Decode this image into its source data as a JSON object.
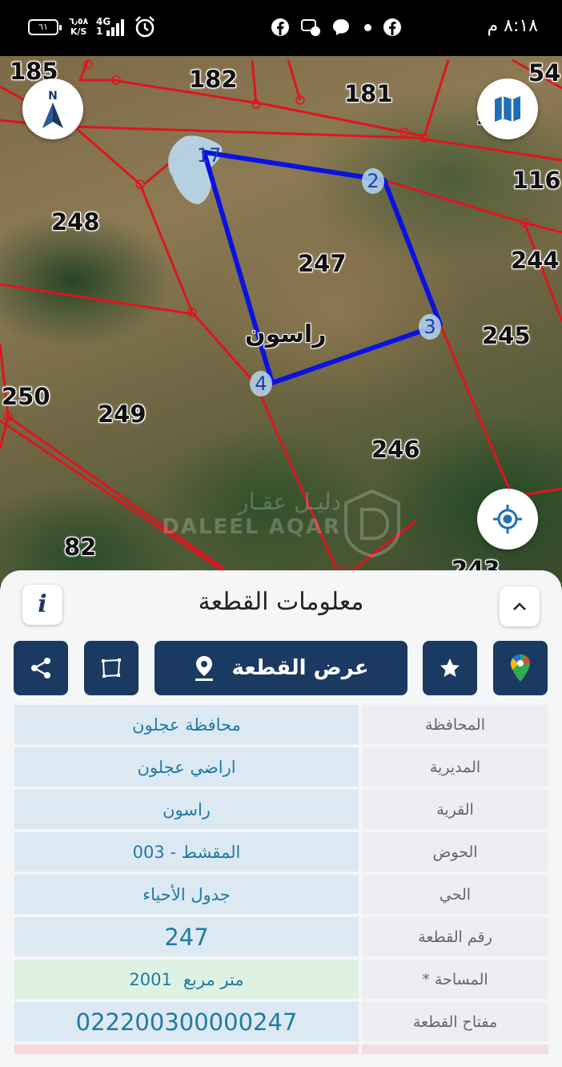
{
  "status_bar": {
    "time": "٨:١٨ م",
    "battery": "٦١",
    "net_speed_value": "٦٫٥٨",
    "net_speed_unit": "K/S",
    "network": "4G",
    "network_sub": "1"
  },
  "map": {
    "plot_numbers": [
      {
        "id": "p185",
        "label": "185"
      },
      {
        "id": "p182",
        "label": "182"
      },
      {
        "id": "p181",
        "label": "181"
      },
      {
        "id": "p54",
        "label": "54"
      },
      {
        "id": "p1",
        "label": "1"
      },
      {
        "id": "p116",
        "label": "116"
      },
      {
        "id": "p248",
        "label": "248"
      },
      {
        "id": "p247",
        "label": "247"
      },
      {
        "id": "p244",
        "label": "244"
      },
      {
        "id": "p245",
        "label": "245"
      },
      {
        "id": "p250",
        "label": "250"
      },
      {
        "id": "p249",
        "label": "249"
      },
      {
        "id": "p246",
        "label": "246"
      },
      {
        "id": "p82",
        "label": "82"
      },
      {
        "id": "p243",
        "label": "243"
      }
    ],
    "vertices": [
      "17",
      "2",
      "3",
      "4"
    ],
    "village_label": "راسون",
    "watermark_ar": "دليـل عقـار",
    "watermark_en": "DALEEL AQAR",
    "parcel_outline_color": "#0a12e0",
    "boundary_color": "#e0141e"
  },
  "sheet": {
    "title": "معلومات القطعة",
    "info_icon": "i",
    "show_plot_label": "عرض القطعة",
    "rows": [
      {
        "label": "المحافظة",
        "value": "محافظة عجلون"
      },
      {
        "label": "المديرية",
        "value": "اراضي عجلون"
      },
      {
        "label": "القرية",
        "value": "راسون"
      },
      {
        "label": "الحوض",
        "value": "المقشط - 003"
      },
      {
        "label": "الحي",
        "value": "جدول الأحياء"
      },
      {
        "label": "رقم القطعة",
        "value": "247"
      },
      {
        "label": "المساحة *",
        "value": "2001",
        "unit": "متر مربع"
      },
      {
        "label": "مفتاح القطعة",
        "value": "022200300000247"
      }
    ]
  },
  "colors": {
    "primary": "#1b3a62",
    "value_text": "#1f7aa6",
    "value_bg": "#dde9f2",
    "area_bg": "#def2e3",
    "label_bg": "#eceef1"
  }
}
